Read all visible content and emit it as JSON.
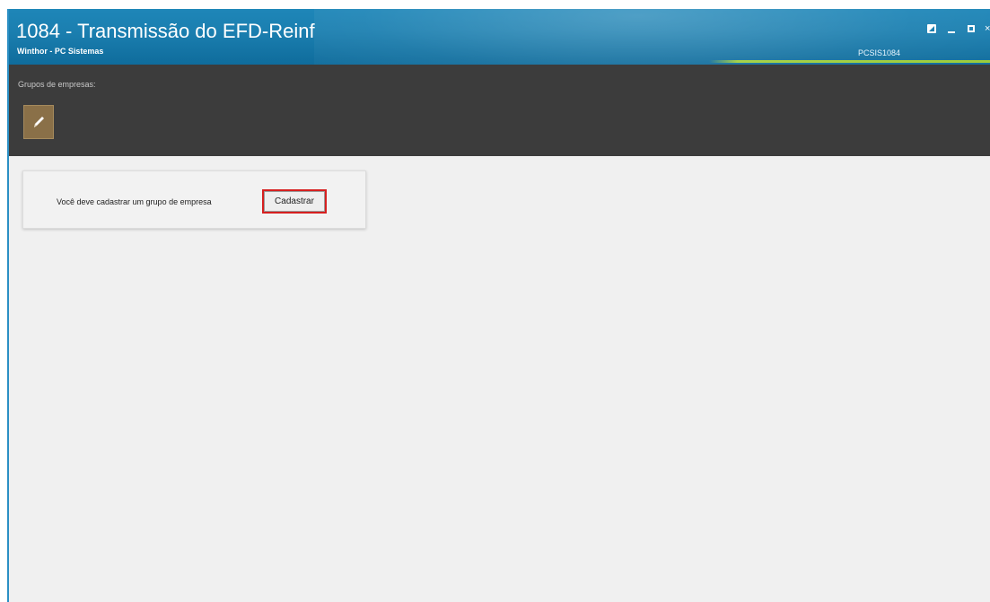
{
  "window": {
    "title": "1084 - Transmissão do EFD-Reinf",
    "subtitle": "Winthor - PC Sistemas",
    "routine_code": "PCSIS1084",
    "controls": {
      "restore_icon": "restore-icon",
      "minimize_icon": "minimize-icon",
      "maximize_icon": "maximize-icon",
      "close_icon": "close-icon",
      "close_glyph": "×"
    }
  },
  "toolbar": {
    "label": "Grupos de empresas:",
    "edit_icon": "pencil-icon"
  },
  "card": {
    "message": "Você deve cadastrar um grupo de empresa",
    "button_label": "Cadastrar"
  },
  "colors": {
    "titlebar": "#1b7fb0",
    "toolbar": "#3c3c3c",
    "edit_button": "#8a7048",
    "highlight": "#d62020",
    "accent_green": "#9ccc3c"
  }
}
